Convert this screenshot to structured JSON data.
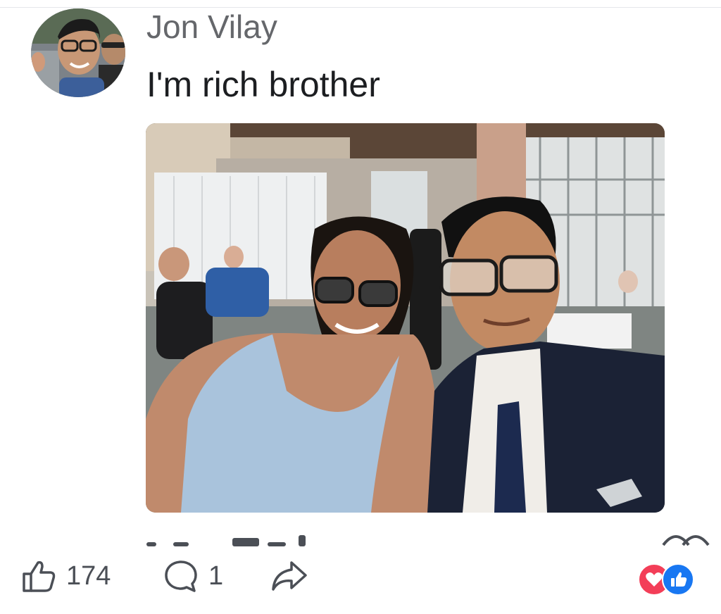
{
  "post": {
    "author_name": "Jon Vilay",
    "text": "I'm rich brother"
  },
  "actions": {
    "like_count": "174",
    "comment_count": "1"
  },
  "reactions": [
    "love-reaction-icon",
    "like-reaction-icon"
  ],
  "colors": {
    "author_gray": "#65676b",
    "text_dark": "#1c1e21",
    "love_red": "#f33e58",
    "like_blue": "#1877f2"
  }
}
